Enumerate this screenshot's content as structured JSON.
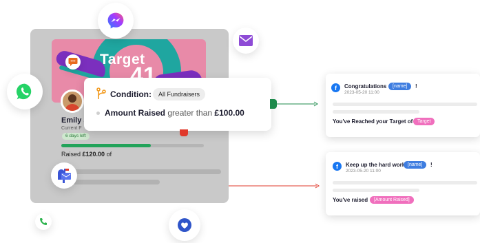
{
  "colors": {
    "whatsapp": "#25d366",
    "messenger": "#8c3bff",
    "email": "#8e4bd6",
    "mailbox": "#3b55d6",
    "phone": "#2bb24c",
    "heart": "#2f55c9",
    "connector_green": "#1d8a4b",
    "connector_red": "#e0392b",
    "progress": "#22a35a",
    "name_tag": "#3e7de0",
    "field_tag": "#f06fbd"
  },
  "fundraiser": {
    "banner_word": "Target",
    "banner_number": "41",
    "name": "Emily S",
    "role": "Current F",
    "days_left": "6 days left",
    "progress_fraction": 0.63,
    "raised_prefix": "Raised",
    "raised_amount": "£120.00",
    "raised_suffix": "of"
  },
  "condition": {
    "label": "Condition:",
    "chip": "All Fundraisers",
    "metric": "Amount Raised",
    "operator": "greater than",
    "value": "£100.00"
  },
  "messages": [
    {
      "title": "Congratulations",
      "name_tag": "[name]",
      "exclaim": "!",
      "date": "2023-05-20 11:00",
      "body": "You've Reached your Target of",
      "body_tag": "Target"
    },
    {
      "title": "Keep up the hard work",
      "name_tag": "[name]",
      "exclaim": "!",
      "date": "2023-05-20 11:00",
      "body": "You've raised",
      "body_tag": "[Amount Raised]"
    }
  ],
  "icons": {
    "whatsapp": "whatsapp-icon",
    "messenger": "messenger-icon",
    "email": "envelope-icon",
    "chat": "chat-bubble-icon",
    "mailbox": "mailbox-icon",
    "phone": "phone-icon",
    "heart": "heart-icon",
    "facebook": "facebook-icon",
    "branch": "branch-icon"
  }
}
